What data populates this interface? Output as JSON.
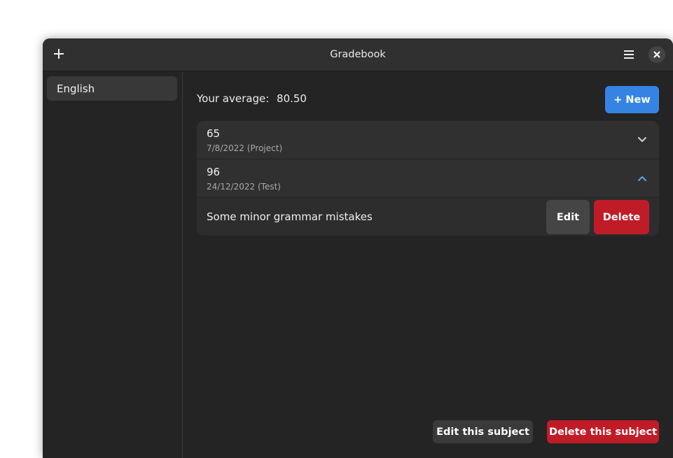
{
  "window": {
    "title": "Gradebook"
  },
  "header": {
    "add_icon": "plus-icon",
    "menu_icon": "hamburger-menu-icon",
    "close_icon": "close-icon"
  },
  "sidebar": {
    "items": [
      {
        "label": "English",
        "selected": true
      }
    ]
  },
  "main": {
    "average_label": "Your average:",
    "average_value": "80.50",
    "new_button_label": "+ New",
    "grades": [
      {
        "score": "65",
        "subtitle": "7/8/2022 (Project)",
        "expanded": false,
        "chevron_icon": "chevron-down-icon"
      },
      {
        "score": "96",
        "subtitle": "24/12/2022 (Test)",
        "expanded": true,
        "chevron_icon": "chevron-up-icon",
        "note": "Some minor grammar mistakes",
        "edit_label": "Edit",
        "delete_label": "Delete"
      }
    ],
    "edit_subject_label": "Edit this subject",
    "delete_subject_label": "Delete this subject"
  },
  "colors": {
    "accent": "#3584e4",
    "destructive": "#c01c28",
    "window_bg": "#242424",
    "header_bg": "#303030"
  }
}
